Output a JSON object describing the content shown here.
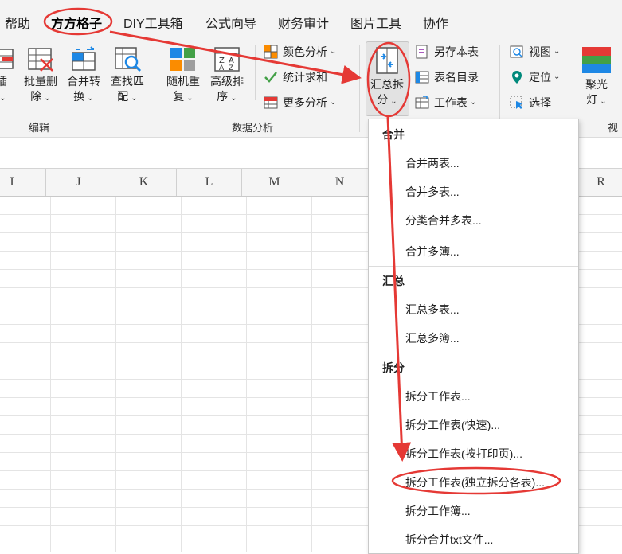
{
  "tabs": [
    "帮助",
    "方方格子",
    "DIY工具箱",
    "公式向导",
    "财务审计",
    "图片工具",
    "协作"
  ],
  "ribbon": {
    "edit_group": {
      "label": "编辑",
      "buttons": [
        {
          "line1": "插",
          "line2": "",
          "caret": "⌄"
        },
        {
          "line1": "批量删",
          "line2": "除",
          "caret": "⌄"
        },
        {
          "line1": "合并转",
          "line2": "换",
          "caret": "⌄"
        },
        {
          "line1": "查找匹",
          "line2": "配",
          "caret": "⌄"
        }
      ]
    },
    "analysis_group": {
      "label": "数据分析",
      "buttons": [
        {
          "line1": "随机重",
          "line2": "复",
          "caret": "⌄"
        },
        {
          "line1": "高级排",
          "line2": "序",
          "caret": "⌄"
        }
      ],
      "small": [
        {
          "label": "颜色分析",
          "caret": "⌄"
        },
        {
          "label": "统计求和",
          "caret": ""
        },
        {
          "label": "更多分析",
          "caret": "⌄"
        }
      ]
    },
    "merge_group": {
      "button": {
        "line1": "汇总拆",
        "line2": "分",
        "caret": "⌄"
      },
      "small": [
        {
          "label": "另存本表",
          "caret": ""
        },
        {
          "label": "表名目录",
          "caret": ""
        },
        {
          "label": "工作表",
          "caret": "⌄"
        }
      ]
    },
    "view_group": {
      "small": [
        {
          "label": "视图",
          "caret": "⌄"
        },
        {
          "label": "定位",
          "caret": "⌄"
        },
        {
          "label": "选择",
          "caret": ""
        }
      ],
      "spotlight": {
        "line1": "聚光",
        "line2": "灯",
        "caret": "⌄"
      },
      "label_partial": "视图"
    }
  },
  "columns": [
    "I",
    "J",
    "K",
    "L",
    "M",
    "N",
    "R"
  ],
  "menu": {
    "sections": [
      {
        "title": "合并",
        "items": [
          "合并两表...",
          "合并多表...",
          "分类合并多表...",
          "合并多簿..."
        ]
      },
      {
        "title": "汇总",
        "items": [
          "汇总多表...",
          "汇总多簿..."
        ]
      },
      {
        "title": "拆分",
        "items": [
          "拆分工作表...",
          "拆分工作表(快速)...",
          "拆分工作表(按打印页)...",
          "拆分工作表(独立拆分各表)...",
          "拆分工作簿...",
          "拆分合并txt文件..."
        ]
      }
    ]
  },
  "colors": {
    "annotation_red": "#e53935",
    "ribbon_bg": "#f3f3f3",
    "menu_bg": "#ffffff"
  }
}
